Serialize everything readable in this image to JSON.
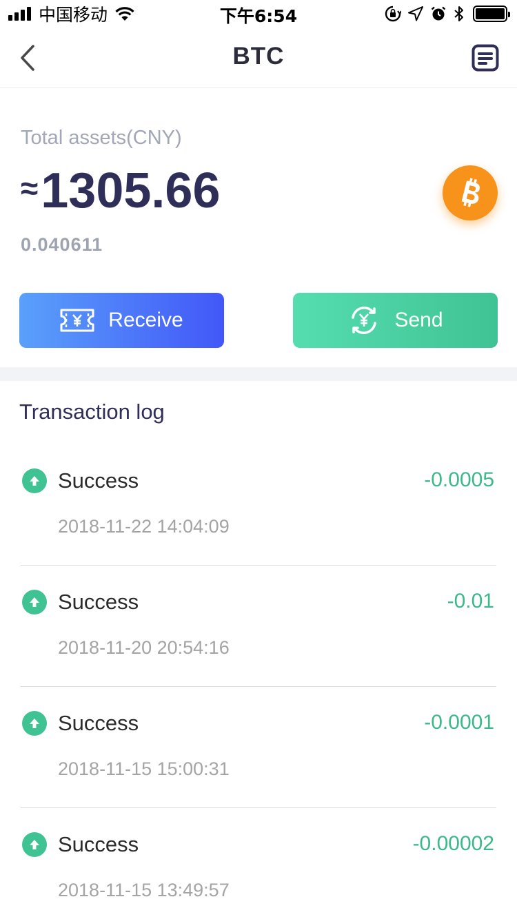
{
  "status_bar": {
    "carrier": "中国移动",
    "time": "下午6:54"
  },
  "nav": {
    "title": "BTC",
    "back_icon": "chevron-left-icon",
    "right_icon": "document-icon"
  },
  "assets": {
    "label": "Total assets(CNY)",
    "approx_symbol": "≈",
    "value": "1305.66",
    "amount": "0.040611",
    "coin_icon": "bitcoin-icon"
  },
  "actions": {
    "receive_label": "Receive",
    "send_label": "Send"
  },
  "colors": {
    "receive_gradient": [
      "#5aa0fb",
      "#4257f8"
    ],
    "send_gradient": [
      "#55ddb0",
      "#40c394"
    ],
    "amount_color": "#3bb98a",
    "bitcoin": "#f7931a",
    "title_color": "#2e2e58"
  },
  "transactions": {
    "title": "Transaction log",
    "items": [
      {
        "status": "Success",
        "amount": "-0.0005",
        "time": "2018-11-22 14:04:09",
        "icon": "arrow-up-icon"
      },
      {
        "status": "Success",
        "amount": "-0.01",
        "time": "2018-11-20 20:54:16",
        "icon": "arrow-up-icon"
      },
      {
        "status": "Success",
        "amount": "-0.0001",
        "time": "2018-11-15 15:00:31",
        "icon": "arrow-up-icon"
      },
      {
        "status": "Success",
        "amount": "-0.00002",
        "time": "2018-11-15 13:49:57",
        "icon": "arrow-up-icon"
      }
    ]
  }
}
